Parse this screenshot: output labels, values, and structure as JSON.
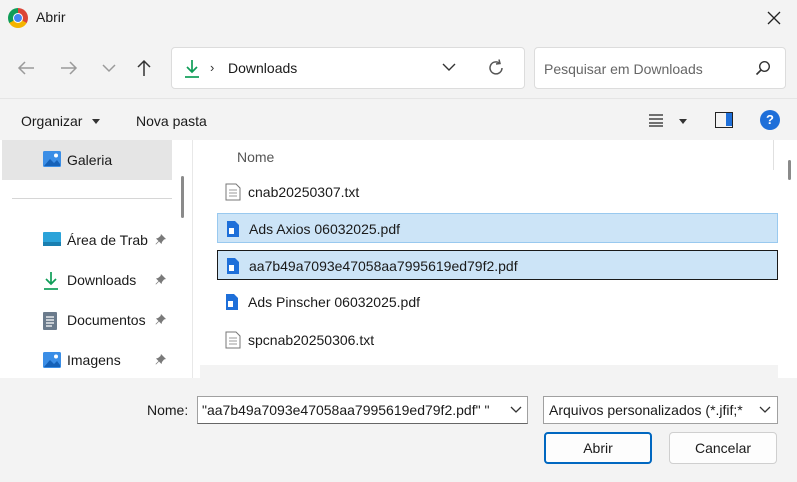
{
  "window": {
    "title": "Abrir"
  },
  "address": {
    "current_folder": "Downloads",
    "separator": "›"
  },
  "search": {
    "placeholder": "Pesquisar em Downloads"
  },
  "toolbar": {
    "organize_label": "Organizar",
    "new_folder_label": "Nova pasta"
  },
  "sidebar": {
    "gallery": "Galeria",
    "items": [
      {
        "label": "Área de Trab",
        "icon": "desktop-icon",
        "pinned": true
      },
      {
        "label": "Downloads",
        "icon": "download-icon",
        "pinned": true
      },
      {
        "label": "Documentos",
        "icon": "document-icon",
        "pinned": true
      },
      {
        "label": "Imagens",
        "icon": "pictures-icon",
        "pinned": true
      }
    ]
  },
  "file_list": {
    "column_name": "Nome",
    "files": [
      {
        "name": "cnab20250307.txt",
        "icon": "text-file-icon",
        "state": "normal"
      },
      {
        "name": "Ads Axios 06032025.pdf",
        "icon": "pdf-file-icon",
        "state": "selected"
      },
      {
        "name": "aa7b49a7093e47058aa7995619ed79f2.pdf",
        "icon": "pdf-file-icon",
        "state": "focused"
      },
      {
        "name": "Ads Pinscher 06032025.pdf",
        "icon": "pdf-file-icon",
        "state": "normal"
      },
      {
        "name": "spcnab20250306.txt",
        "icon": "text-file-icon",
        "state": "normal"
      }
    ]
  },
  "footer": {
    "name_label": "Nome:",
    "name_value": "\"aa7b49a7093e47058aa7995619ed79f2.pdf\" \"",
    "file_type": "Arquivos personalizados (*.jfif;*",
    "open_label": "Abrir",
    "cancel_label": "Cancelar"
  },
  "colors": {
    "accent": "#0067c0",
    "selection": "#cce4f7",
    "selection_border": "#99c9ef",
    "pdf_icon": "#1e6fd9"
  }
}
